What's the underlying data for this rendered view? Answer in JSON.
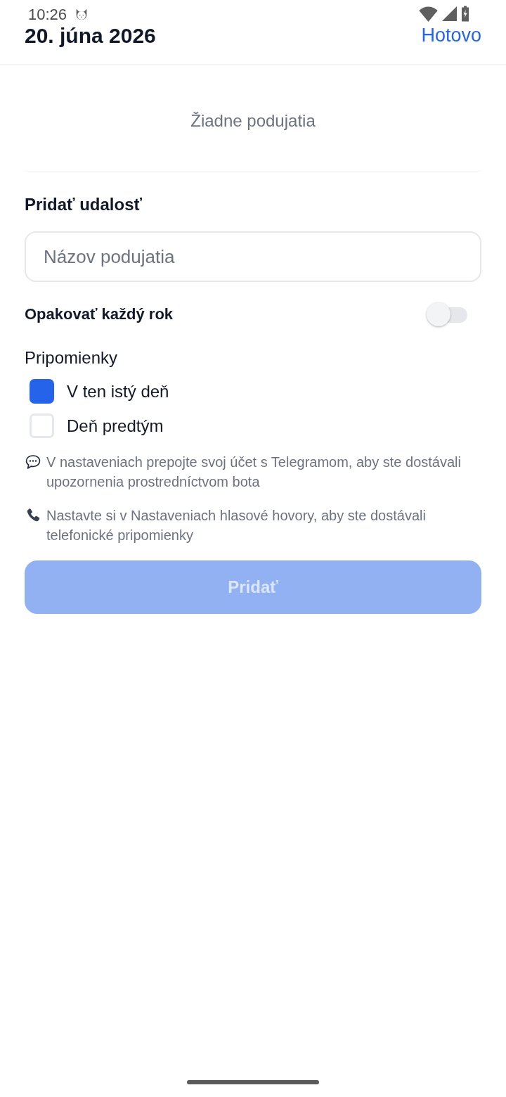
{
  "status_bar": {
    "time": "10:26"
  },
  "header": {
    "title": "20. júna 2026",
    "done_link": "Hotovo"
  },
  "events": {
    "empty_text": "Žiadne podujatia"
  },
  "add_event": {
    "heading": "Pridať udalosť",
    "name_field": {
      "placeholder": "Názov podujatia"
    },
    "repeat": {
      "label": "Opakovať každý rok",
      "on": false
    },
    "reminders": {
      "heading": "Pripomienky",
      "options": [
        {
          "label": "V ten istý deň",
          "checked": true
        },
        {
          "label": "Deň predtým",
          "checked": false
        }
      ]
    },
    "notes": [
      {
        "kind": "chat",
        "text": "V nastaveniach prepojte svoj účet s Telegramom, aby ste dostávali upozornenia prostredníctvom bota"
      },
      {
        "kind": "phone",
        "text": "Nastavte si v Nastaveniach hlasové hovory, aby ste dostávali telefonické pripomienky"
      }
    ],
    "submit": {
      "label": "Pridať",
      "disabled": true
    }
  }
}
